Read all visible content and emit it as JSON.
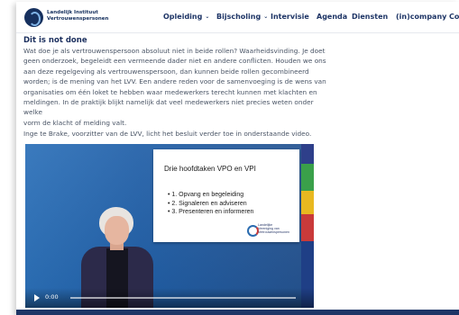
{
  "logo": {
    "line1": "Landelijk Instituut",
    "line2": "Vertrouwenspersonen"
  },
  "nav": [
    {
      "label": "Opleiding",
      "dropdown": true
    },
    {
      "label": "Bijscholing",
      "dropdown": true
    },
    {
      "label": "Intervisie",
      "dropdown": false
    },
    {
      "label": "Agenda",
      "dropdown": false
    },
    {
      "label": "Diensten",
      "dropdown": false
    },
    {
      "label": "(in)company",
      "dropdown": false
    },
    {
      "label": "Co",
      "dropdown": false
    }
  ],
  "article": {
    "heading": "Dit is not done",
    "lines": [
      "Wat doe je als vertrouwenspersoon absoluut niet in beide rollen? Waarheidsvinding. Je doet",
      "geen onderzoek, begeleidt een vermeende dader niet en andere conflicten. Houden we ons",
      "aan deze regelgeving als vertrouwenspersoon, dan kunnen beide rollen gecombineerd",
      "worden; is de mening van het LVV. Een andere reden voor de samenvoeging is de wens van",
      "organisaties om één loket te hebben waar medewerkers terecht kunnen met klachten en",
      "meldingen. In de praktijk blijkt namelijk dat veel medewerkers niet precies weten onder welke",
      "vorm de klacht of melding valt."
    ],
    "intro": "Inge te Brake, voorzitter van de LVV, licht het besluit verder toe in onderstaande video."
  },
  "video": {
    "slide_title": "Drie hoofdtaken VPO en VPI",
    "slide_items": [
      "• 1. Opvang en begeleiding",
      "• 2. Signaleren en adviseren",
      "• 3. Presenteren en informeren"
    ],
    "slide_logo": {
      "line1": "Landelijke",
      "line2": "Vereniging van",
      "line3": "Vertrouwenspersonen"
    },
    "time": "0:00"
  },
  "colors": {
    "brand_navy": "#1e3566",
    "video_blue": "#2a6fb8",
    "accent_red": "#c93a3a",
    "accent_green": "#3aa04a",
    "accent_yellow": "#e8b820"
  }
}
